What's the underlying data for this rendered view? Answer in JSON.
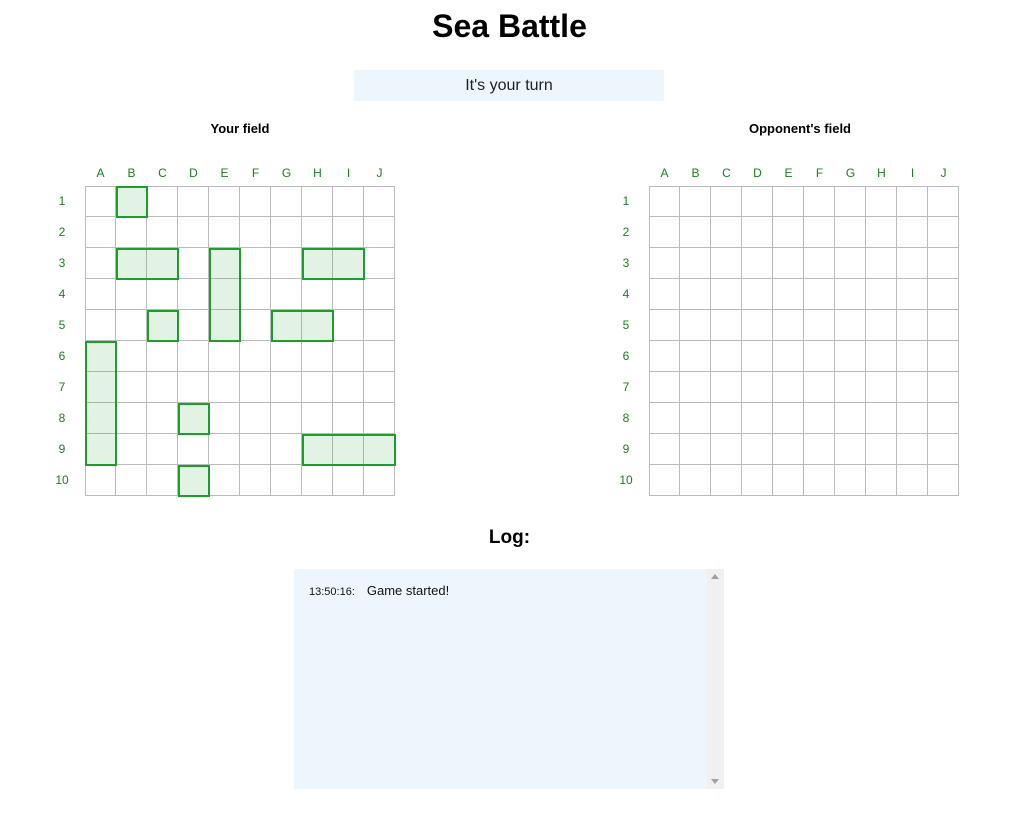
{
  "title": "Sea Battle",
  "status": "It's your turn",
  "your_field": {
    "title": "Your field",
    "ships": [
      {
        "col": "B",
        "row": 1,
        "length": 1,
        "orientation": "horizontal"
      },
      {
        "col": "B",
        "row": 3,
        "length": 2,
        "orientation": "horizontal"
      },
      {
        "col": "E",
        "row": 3,
        "length": 3,
        "orientation": "vertical"
      },
      {
        "col": "H",
        "row": 3,
        "length": 2,
        "orientation": "horizontal"
      },
      {
        "col": "C",
        "row": 5,
        "length": 1,
        "orientation": "horizontal"
      },
      {
        "col": "G",
        "row": 5,
        "length": 2,
        "orientation": "horizontal"
      },
      {
        "col": "A",
        "row": 6,
        "length": 4,
        "orientation": "vertical"
      },
      {
        "col": "D",
        "row": 8,
        "length": 1,
        "orientation": "horizontal"
      },
      {
        "col": "H",
        "row": 9,
        "length": 3,
        "orientation": "horizontal"
      },
      {
        "col": "D",
        "row": 10,
        "length": 1,
        "orientation": "horizontal"
      }
    ]
  },
  "opponent_field": {
    "title": "Opponent's field"
  },
  "columns": [
    "A",
    "B",
    "C",
    "D",
    "E",
    "F",
    "G",
    "H",
    "I",
    "J"
  ],
  "rows": [
    "1",
    "2",
    "3",
    "4",
    "5",
    "6",
    "7",
    "8",
    "9",
    "10"
  ],
  "log": {
    "title": "Log:",
    "entries": [
      {
        "time": "13:50:16:",
        "message": "Game started!"
      }
    ]
  },
  "colors": {
    "ship_border": "#1aa02a",
    "label": "#1a7f1a",
    "status_bg": "#eef6fd"
  }
}
